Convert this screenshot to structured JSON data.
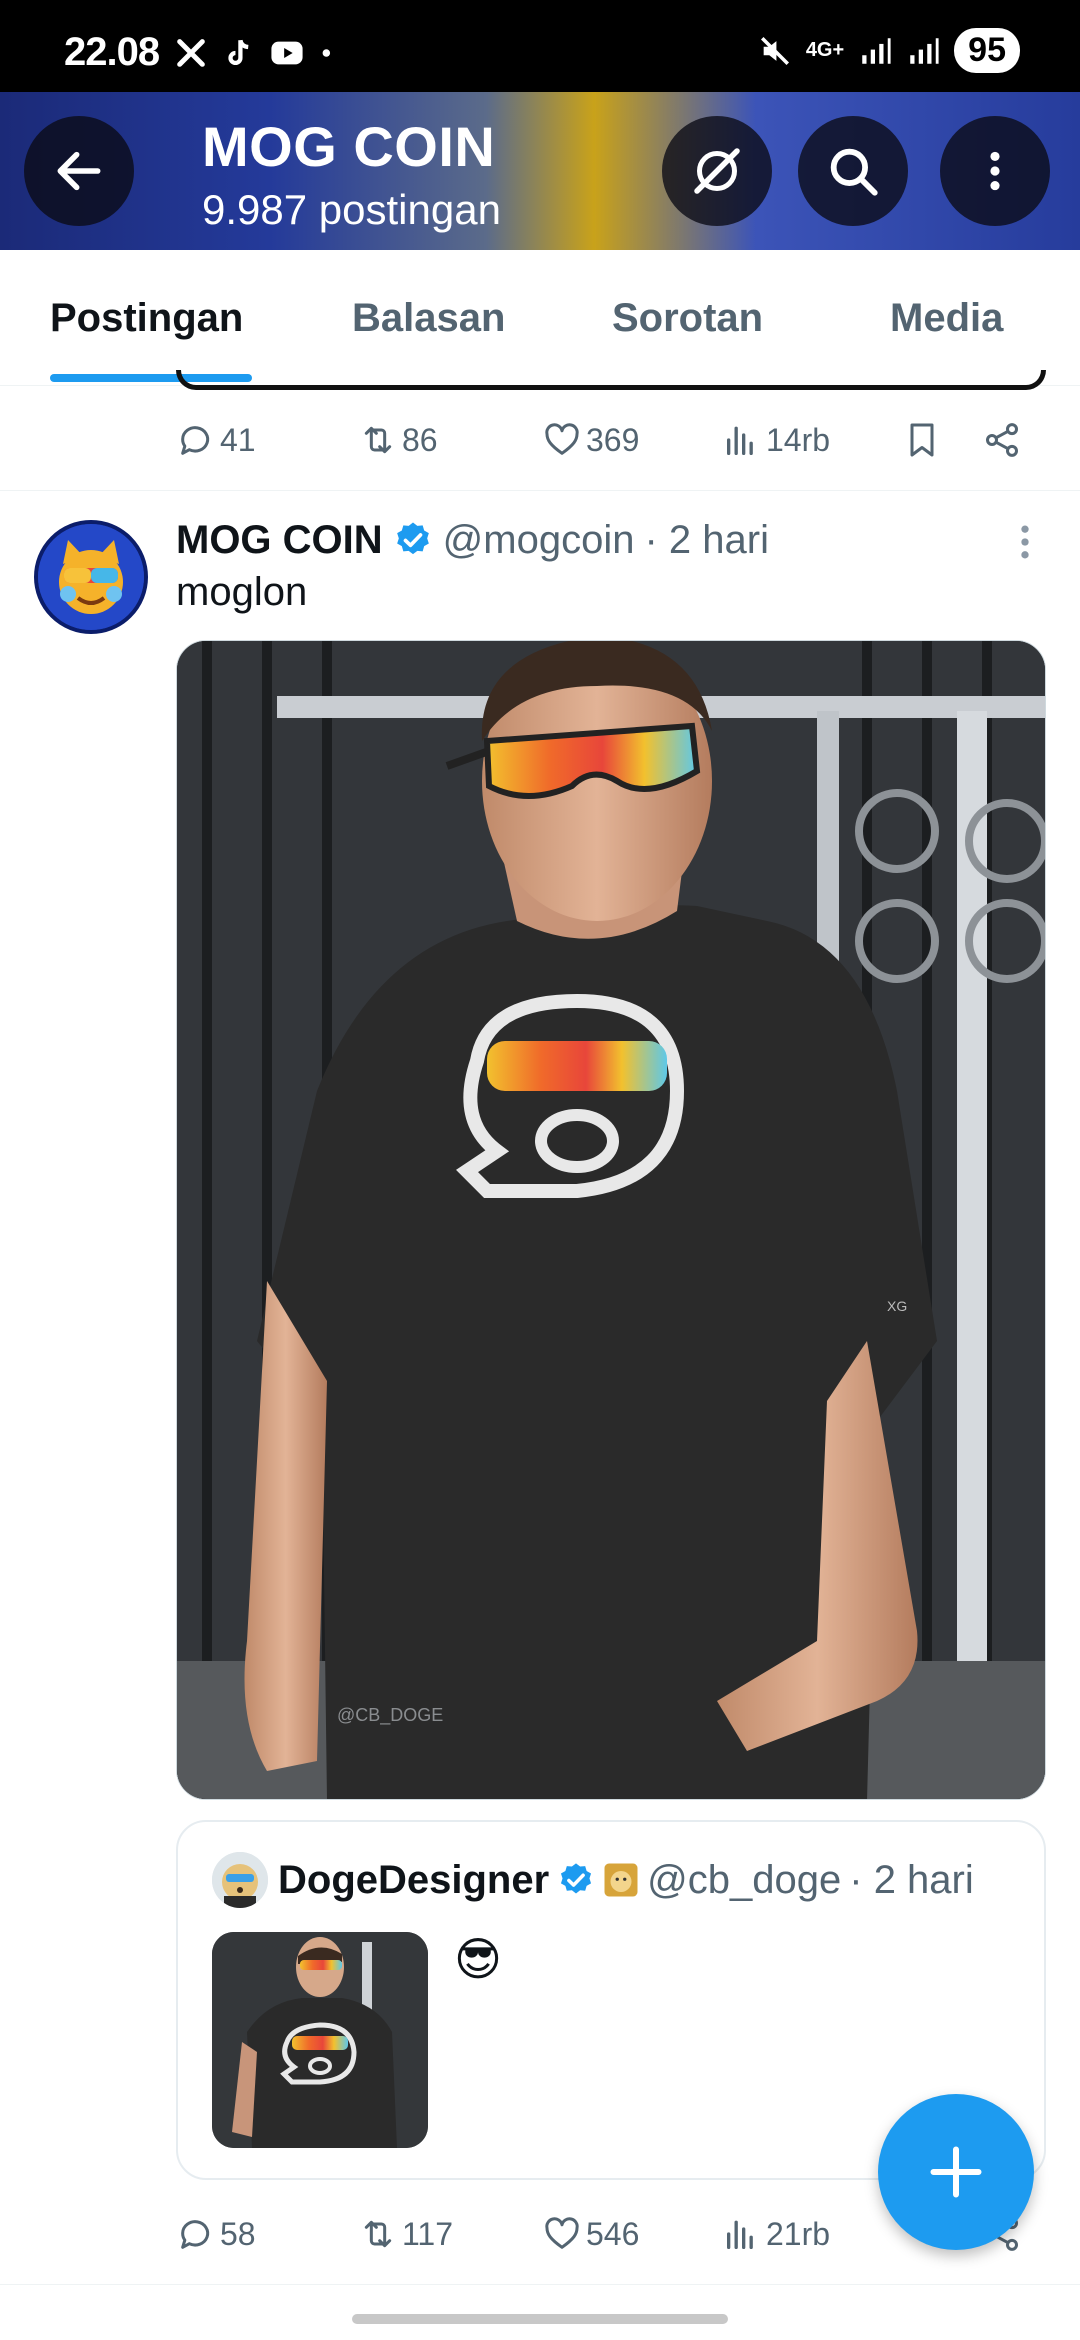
{
  "status_bar": {
    "time": "22.08",
    "network": "4G+",
    "battery": "95"
  },
  "header": {
    "title": "MOG COIN",
    "subtitle": "9.987 postingan"
  },
  "tabs": [
    {
      "label": "Postingan",
      "active": true
    },
    {
      "label": "Balasan",
      "active": false
    },
    {
      "label": "Sorotan",
      "active": false
    },
    {
      "label": "Media",
      "active": false
    }
  ],
  "previous_post": {
    "replies": "41",
    "reposts": "86",
    "likes": "369",
    "views": "14rb"
  },
  "post": {
    "name": "MOG COIN",
    "handle": "@mogcoin",
    "time": "· 2 hari",
    "text": "moglon",
    "photo_watermark": "@CB_DOGE",
    "sleeve_text": "XG",
    "replies": "58",
    "reposts": "117",
    "likes": "546",
    "views": "21rb"
  },
  "quote": {
    "name": "DogeDesigner",
    "handle": "@cb_doge",
    "time": "· 2 hari",
    "emoji": "😎"
  },
  "colors": {
    "accent": "#1d9bf0",
    "muted_text": "#536471",
    "primary_text": "#0f1419"
  }
}
